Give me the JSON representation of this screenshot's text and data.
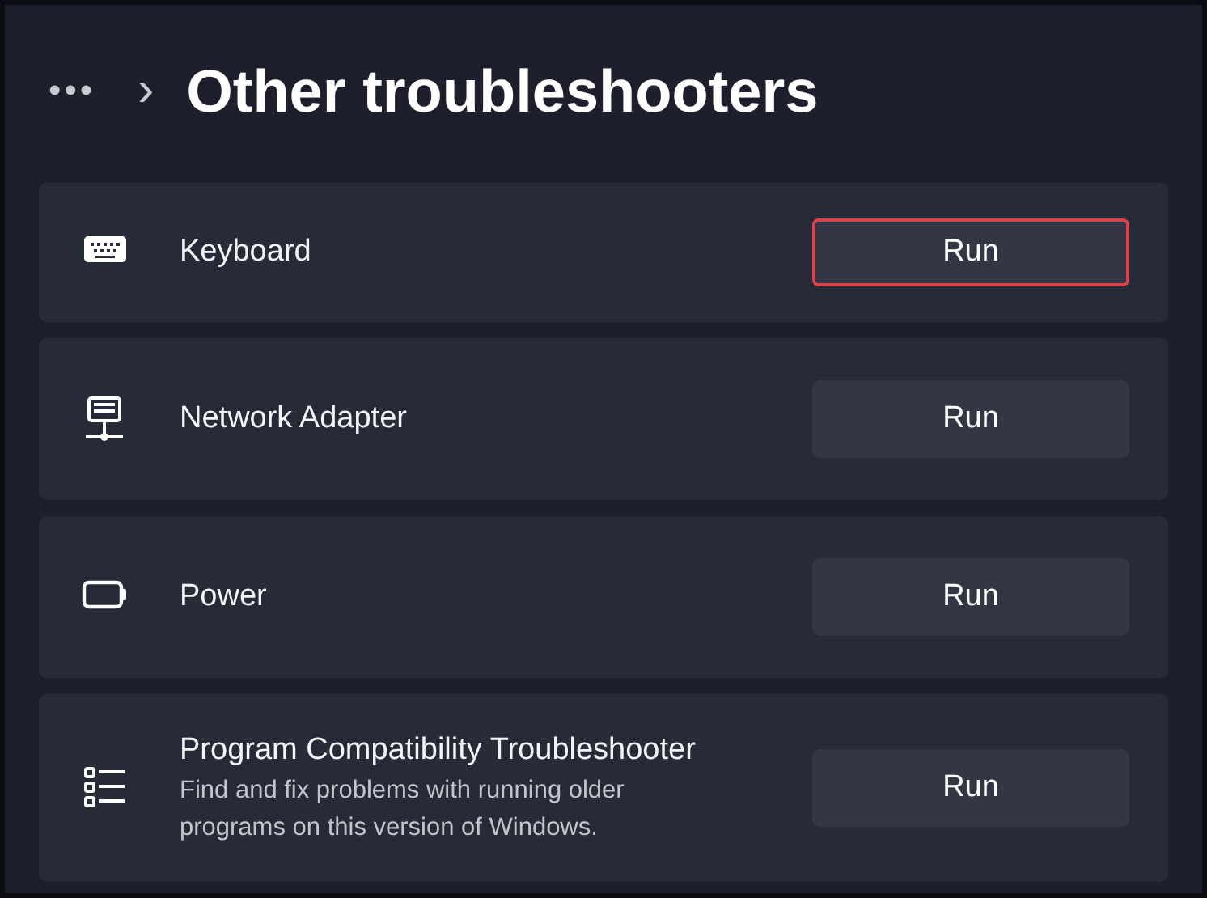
{
  "breadcrumb": {
    "more": "•••",
    "separator": "›",
    "title": "Other troubleshooters"
  },
  "troubleshooters": [
    {
      "name": "Keyboard",
      "button": "Run",
      "highlighted": true
    },
    {
      "name": "Network Adapter",
      "button": "Run",
      "highlighted": false
    },
    {
      "name": "Power",
      "button": "Run",
      "highlighted": false
    },
    {
      "name": "Program Compatibility Troubleshooter",
      "description": "Find and fix problems with running older programs on this version of Windows.",
      "button": "Run",
      "highlighted": false
    }
  ]
}
